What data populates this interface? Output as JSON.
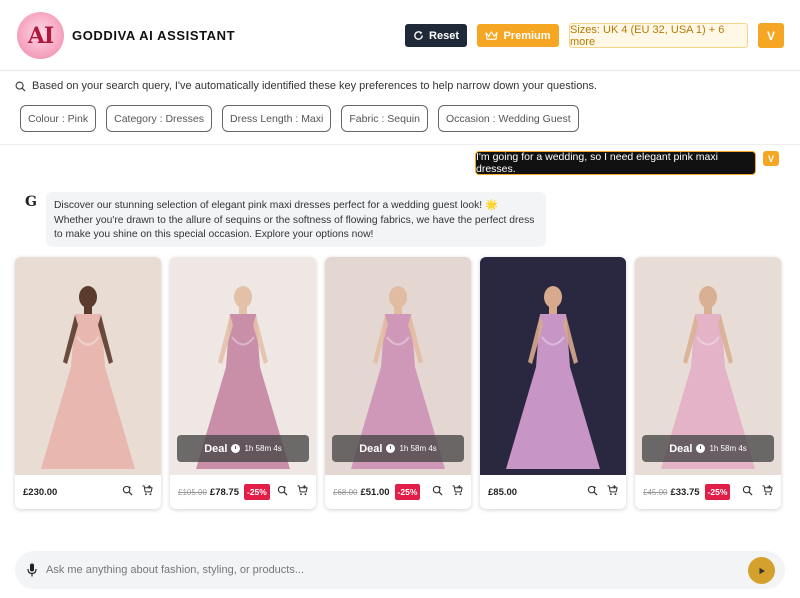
{
  "header": {
    "logo_text": "AI",
    "title": "GODDIVA AI ASSISTANT",
    "reset_label": "Reset",
    "premium_label": "Premium",
    "sizes_label": "Sizes: UK 4 (EU 32, USA 1) + 6 more",
    "user_initial": "V"
  },
  "preferences": {
    "info": "Based on your search query, I've automatically identified these key preferences to help narrow down your questions.",
    "chips": [
      "Colour : Pink",
      "Category : Dresses",
      "Dress Length : Maxi",
      "Fabric : Sequin",
      "Occasion : Wedding Guest"
    ]
  },
  "chat": {
    "user_message": "I'm going for a wedding, so I need elegant pink maxi dresses.",
    "user_initial": "V",
    "bot_initial": "G",
    "bot_message": "Discover our stunning selection of elegant pink maxi dresses perfect for a wedding guest look! 🌟 Whether you're drawn to the allure of sequins or the softness of flowing fabrics, we have the perfect dress to make you shine on this special occasion. Explore your options now!"
  },
  "products": [
    {
      "price": "£230.00",
      "old_price": "",
      "discount": "",
      "deal": false,
      "deal_label": "",
      "timer": "",
      "bg": "#e9dcd3",
      "dress": "#e7b7b0",
      "skin": "#5a3b2c"
    },
    {
      "price": "£78.75",
      "old_price": "£105.00",
      "discount": "-25%",
      "deal": true,
      "deal_label": "Deal",
      "timer": "1h 58m 4s",
      "bg": "#efe7e3",
      "dress": "#c98ea8",
      "skin": "#e3c1a8"
    },
    {
      "price": "£51.00",
      "old_price": "£68.00",
      "discount": "-25%",
      "deal": true,
      "deal_label": "Deal",
      "timer": "1h 58m 4s",
      "bg": "#e4d6d0",
      "dress": "#cf98b8",
      "skin": "#e2bca2"
    },
    {
      "price": "£85.00",
      "old_price": "",
      "discount": "",
      "deal": false,
      "deal_label": "",
      "timer": "",
      "bg": "#2a2740",
      "dress": "#c796c6",
      "skin": "#d7aa8e"
    },
    {
      "price": "£33.75",
      "old_price": "£45.00",
      "discount": "-25%",
      "deal": true,
      "deal_label": "Deal",
      "timer": "1h 58m 4s",
      "bg": "#e8ddd6",
      "dress": "#e5b3c7",
      "skin": "#d9b093"
    }
  ],
  "input": {
    "placeholder": "Ask me anything about fashion, styling, or products..."
  },
  "colors": {
    "accent": "#f5a623",
    "dark": "#1f2937",
    "discount": "#e11d48",
    "send": "#d4a22c"
  },
  "icons": [
    "refresh-icon",
    "crown-icon",
    "search-icon",
    "sparkle-icon",
    "zoom-icon",
    "cart-icon",
    "clock-icon",
    "mic-icon",
    "send-icon"
  ]
}
